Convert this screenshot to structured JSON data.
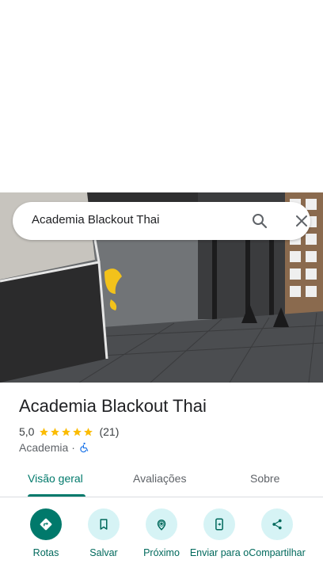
{
  "search": {
    "query": "Academia Blackout Thai"
  },
  "place": {
    "name": "Academia Blackout Thai",
    "rating": "5,0",
    "reviews_count": "(21)",
    "category": "Academia",
    "separator": "·",
    "stars_filled": 5
  },
  "tabs": [
    {
      "label": "Visão geral",
      "active": true
    },
    {
      "label": "Avaliações",
      "active": false
    },
    {
      "label": "Sobre",
      "active": false
    }
  ],
  "actions": [
    {
      "label": "Rotas",
      "icon": "directions-icon"
    },
    {
      "label": "Salvar",
      "icon": "bookmark-icon"
    },
    {
      "label": "Próximo",
      "icon": "nearby-icon"
    },
    {
      "label": "Enviar para o",
      "icon": "send-to-phone-icon"
    },
    {
      "label": "Compartilhar",
      "icon": "share-icon"
    }
  ],
  "colors": {
    "accent": "#00796b",
    "action_bg": "#d6f3f5",
    "star": "#fbbc04"
  }
}
